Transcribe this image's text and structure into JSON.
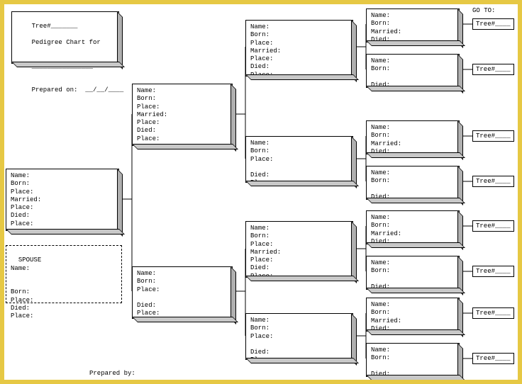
{
  "header": {
    "tree_prefix": "Tree#_______",
    "chart_for": "Pedigree Chart for",
    "underline": "________________",
    "prepared_on": "Prepared on:  __/__/____",
    "goto": "GO TO:",
    "prepared_by": "Prepared by:"
  },
  "fieldsets": {
    "full7": "Name:\nBorn:\nPlace:\nMarried:\nPlace:\nDied:\nPlace:",
    "died4": "Name:\nBorn:\nPlace:\n\nDied:\nPlace:",
    "married4": "Name:\nBorn:\nMarried:\nDied:",
    "died3": "Name:\nBorn:\n\nDied:"
  },
  "spouse": {
    "header": "SPOUSE\nName:",
    "body": "Born:\nPlace:\nDied:\nPlace:"
  },
  "tree_tag": "Tree#____"
}
